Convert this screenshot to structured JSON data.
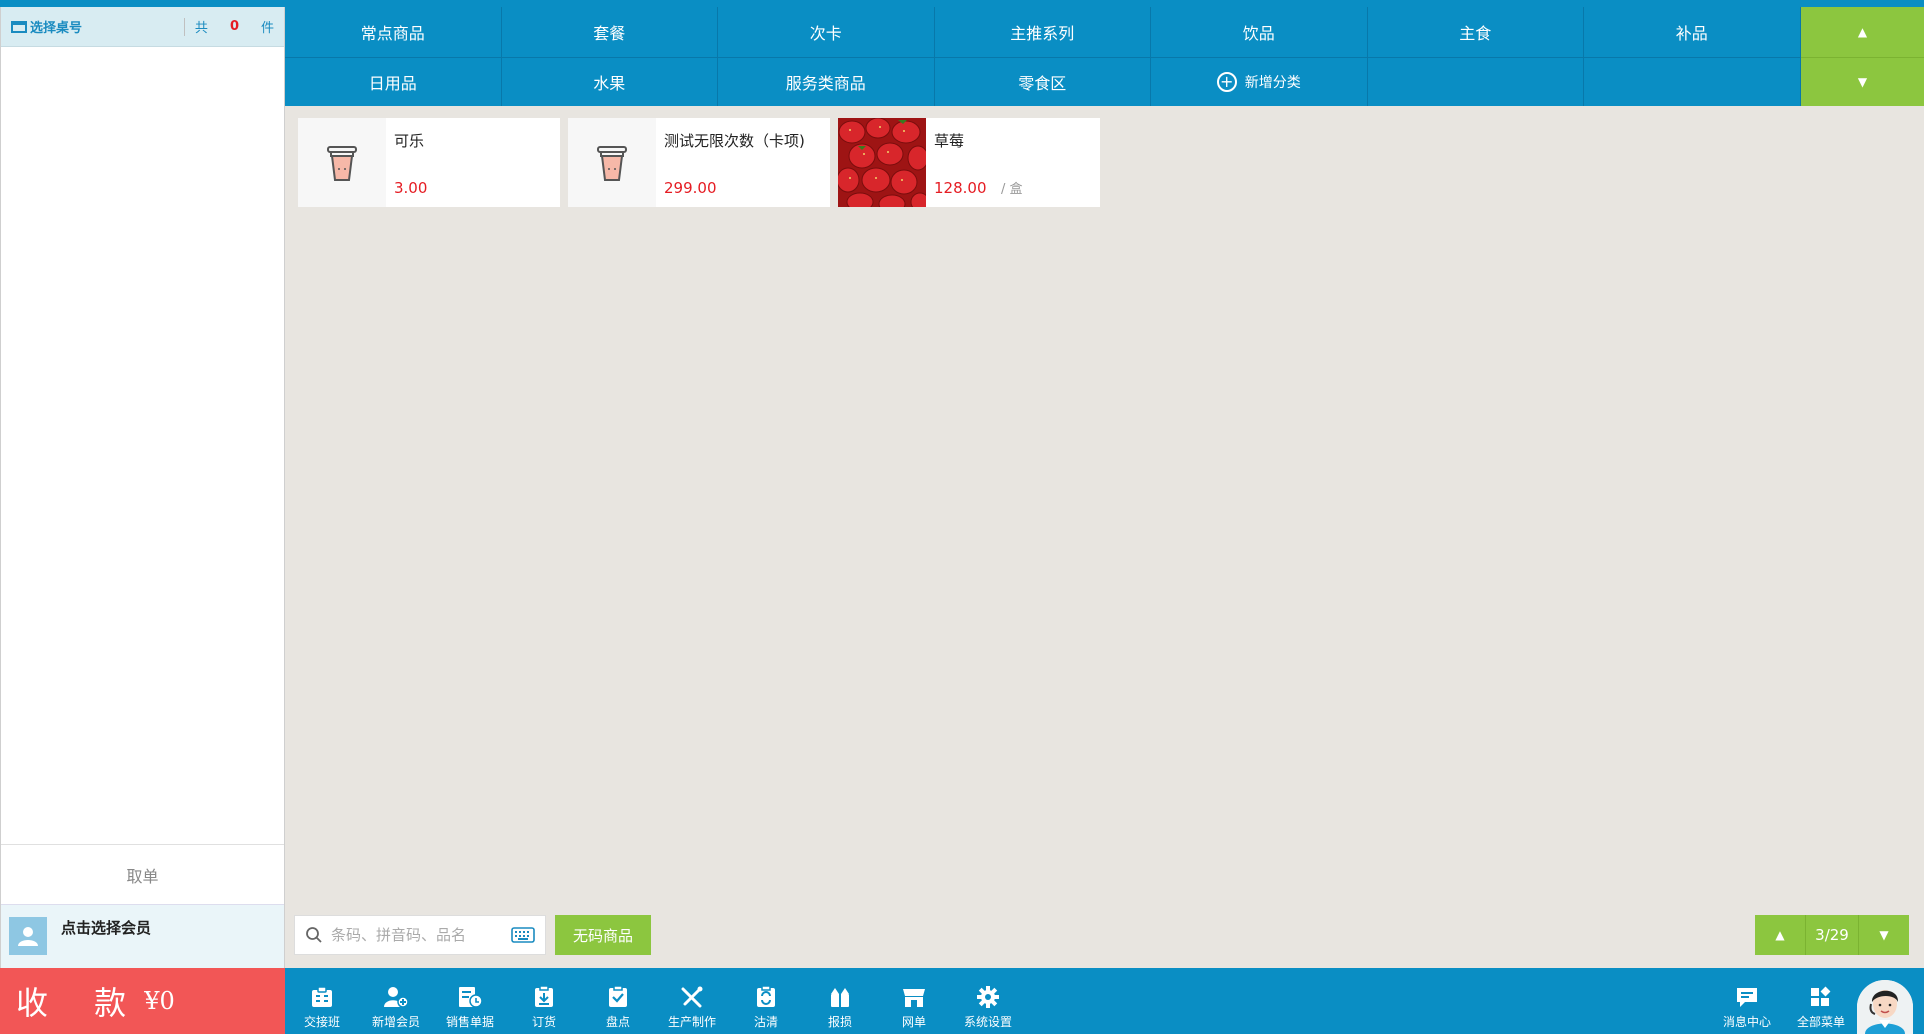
{
  "left_panel": {
    "table_select": "选择桌号",
    "count_prefix": "共",
    "count_value": "0",
    "count_suffix": "件",
    "cancel": "取单",
    "member": "点击选择会员",
    "pay_label": "收 款",
    "pay_amount": "¥0"
  },
  "categories": {
    "row1": [
      "常点商品",
      "套餐",
      "次卡",
      "主推系列",
      "饮品",
      "主食",
      "补品"
    ],
    "row2": [
      "日用品",
      "水果",
      "服务类商品",
      "零食区",
      "新增分类",
      "",
      ""
    ]
  },
  "products": [
    {
      "name": "可乐",
      "price": "3.00",
      "unit": "",
      "thumb": "cup-icon"
    },
    {
      "name": "测试无限次数（卡项)",
      "price": "299.00",
      "unit": "",
      "thumb": "cup-icon"
    },
    {
      "name": "草莓",
      "price": "128.00",
      "unit": "/ 盒",
      "thumb": "strawberry-image"
    }
  ],
  "search": {
    "placeholder": "条码、拼音码、品名"
  },
  "nocode_button": "无码商品",
  "pager": {
    "info": "3/29"
  },
  "toolbar": [
    {
      "label": "交接班",
      "icon": "shift-handover-icon"
    },
    {
      "label": "新增会员",
      "icon": "add-member-icon"
    },
    {
      "label": "销售单据",
      "icon": "sales-receipt-icon"
    },
    {
      "label": "订货",
      "icon": "order-goods-icon"
    },
    {
      "label": "盘点",
      "icon": "inventory-check-icon"
    },
    {
      "label": "生产制作",
      "icon": "production-icon"
    },
    {
      "label": "沽清",
      "icon": "sold-out-icon"
    },
    {
      "label": "报损",
      "icon": "damage-report-icon"
    },
    {
      "label": "网单",
      "icon": "online-order-icon"
    },
    {
      "label": "系统设置",
      "icon": "gear-icon"
    }
  ],
  "right_tools": [
    {
      "label": "消息中心",
      "icon": "message-icon"
    },
    {
      "label": "全部菜单",
      "icon": "all-menu-icon"
    }
  ],
  "colors": {
    "primary_blue": "#0a8ec4",
    "accent_green": "#8cc63f",
    "pay_red": "#f25656",
    "price_red": "#e51c23"
  }
}
